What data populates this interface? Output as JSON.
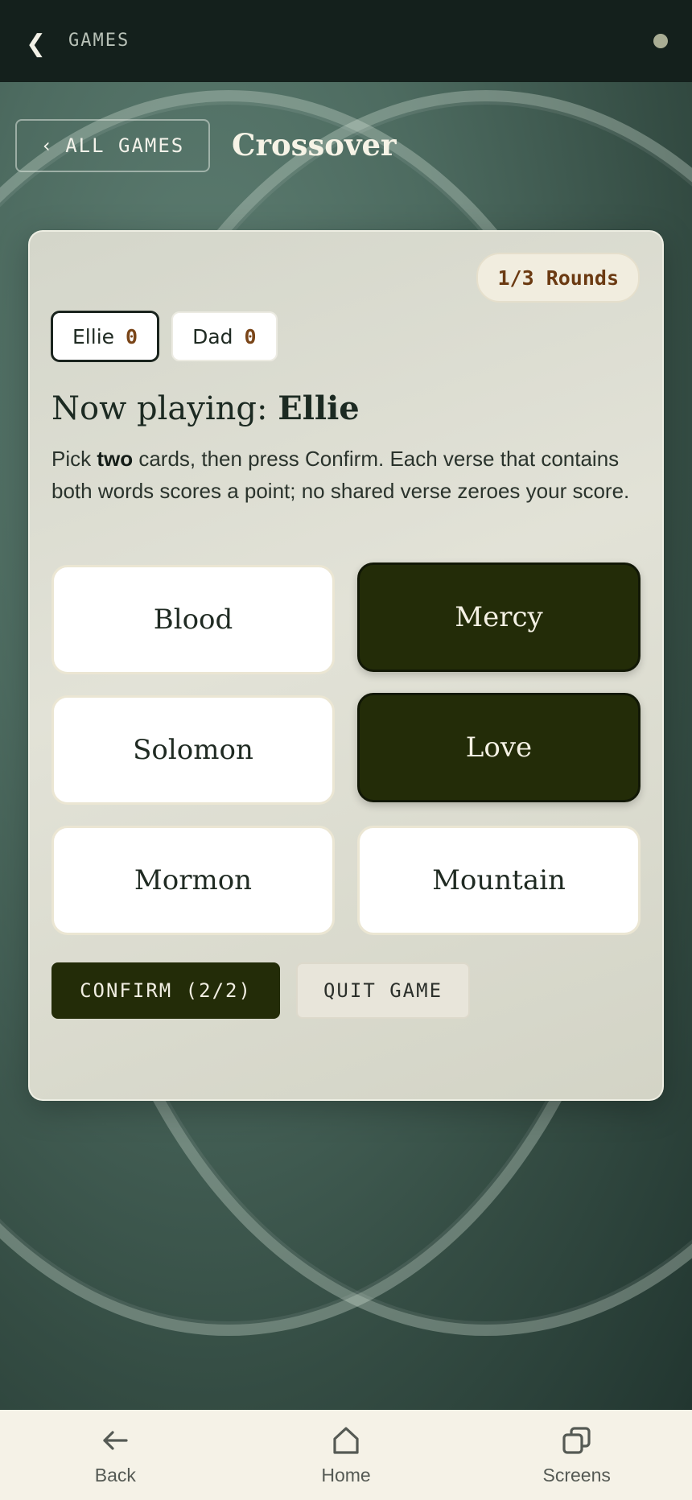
{
  "topbar": {
    "back_icon": "chevron-left-icon",
    "title": "GAMES",
    "status_dot_color": "#a9ad94"
  },
  "header": {
    "all_games_label": "ALL GAMES",
    "all_games_icon": "chevron-left-icon",
    "game_title": "Crossover"
  },
  "game": {
    "rounds_label": "1/3 Rounds",
    "players": [
      {
        "name": "Ellie",
        "score": "0",
        "active": true
      },
      {
        "name": "Dad",
        "score": "0",
        "active": false
      }
    ],
    "now_playing_prefix": "Now playing: ",
    "current_player": "Ellie",
    "instructions": {
      "pre": "Pick ",
      "emphasis": "two",
      "post": " cards, then press Confirm. Each verse that contains both words scores a point; no shared verse zeroes your score."
    },
    "cards": [
      {
        "word": "Blood",
        "selected": false
      },
      {
        "word": "Mercy",
        "selected": true
      },
      {
        "word": "Solomon",
        "selected": false
      },
      {
        "word": "Love",
        "selected": true
      },
      {
        "word": "Mormon",
        "selected": false
      },
      {
        "word": "Mountain",
        "selected": false
      }
    ],
    "confirm_label": "CONFIRM (2/2)",
    "quit_label": "QUIT GAME"
  },
  "bottom_nav": {
    "items": [
      {
        "label": "Back",
        "icon": "arrow-left-icon"
      },
      {
        "label": "Home",
        "icon": "home-icon"
      },
      {
        "label": "Screens",
        "icon": "screens-icon"
      }
    ]
  },
  "colors": {
    "accent_dark": "#232c08",
    "score_brown": "#7a4518",
    "topbar": "#14201c",
    "nav_bg": "#f5f2e7"
  }
}
